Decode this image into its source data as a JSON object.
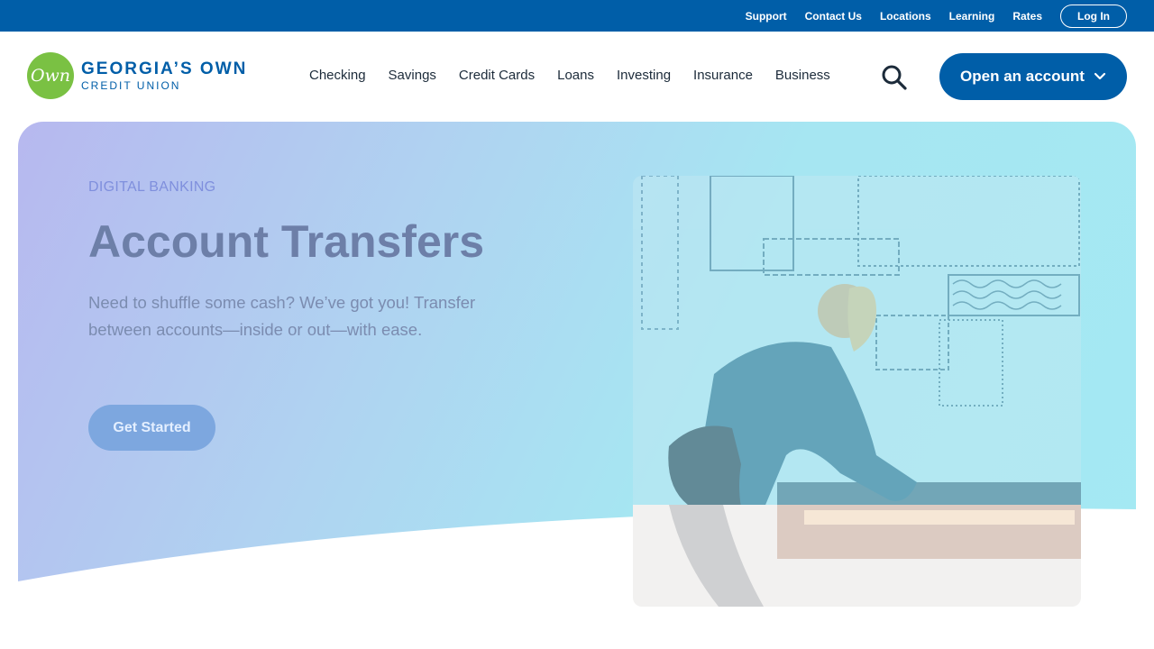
{
  "utility": {
    "links": [
      "Support",
      "Contact Us",
      "Locations",
      "Learning",
      "Rates"
    ],
    "login_label": "Log In"
  },
  "logo": {
    "mark": "Own",
    "line1": "GEORGIA’S OWN",
    "line2": "CREDIT UNION"
  },
  "nav": {
    "items": [
      "Checking",
      "Savings",
      "Credit Cards",
      "Loans",
      "Investing",
      "Insurance",
      "Business"
    ],
    "search_icon": "search-icon",
    "cta_label": "Open an account",
    "cta_icon": "chevron-down-icon"
  },
  "hero": {
    "eyebrow": "DIGITAL BANKING",
    "title": "Account Transfers",
    "body": "Need to shuffle some cash? We’ve got you! Transfer between accounts—inside or out—with ease.",
    "button_label": "Get Started"
  },
  "colors": {
    "brand_blue": "#005ea8",
    "brand_green": "#7ac143",
    "hero_start": "#b7b8ef",
    "hero_end": "#a4e9f3"
  }
}
